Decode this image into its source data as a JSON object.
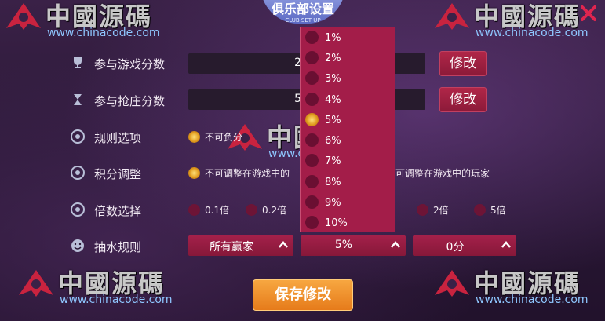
{
  "header": {
    "title": "俱乐部设置",
    "subtitle": "CLUB SET UP"
  },
  "watermark": {
    "text": "中國源碼",
    "url": "www.chinacode.com"
  },
  "rows": {
    "game_score": {
      "label": "参与游戏分数",
      "value": "2",
      "button": "修改"
    },
    "banker_score": {
      "label": "参与抢庄分数",
      "value": "5",
      "button": "修改"
    },
    "rules": {
      "label": "规则选项",
      "options": [
        "不可负分"
      ]
    },
    "points": {
      "label": "积分调整",
      "options": [
        "不可调整在游戏中的",
        "可调整在游戏中的玩家"
      ]
    },
    "multiplier": {
      "label": "倍数选择",
      "options": [
        "0.1倍",
        "0.2倍",
        "2倍",
        "5倍"
      ]
    },
    "commission": {
      "label": "抽水规则",
      "dropdowns": [
        "所有赢家",
        "5%",
        "0分"
      ]
    }
  },
  "menu_items": [
    "1%",
    "2%",
    "3%",
    "4%",
    "5%",
    "6%",
    "7%",
    "8%",
    "9%",
    "10%"
  ],
  "save_button": "保存修改",
  "colors": {
    "accent": "#a31d49",
    "save": "#f0912d",
    "header": "#6f7fd6"
  }
}
